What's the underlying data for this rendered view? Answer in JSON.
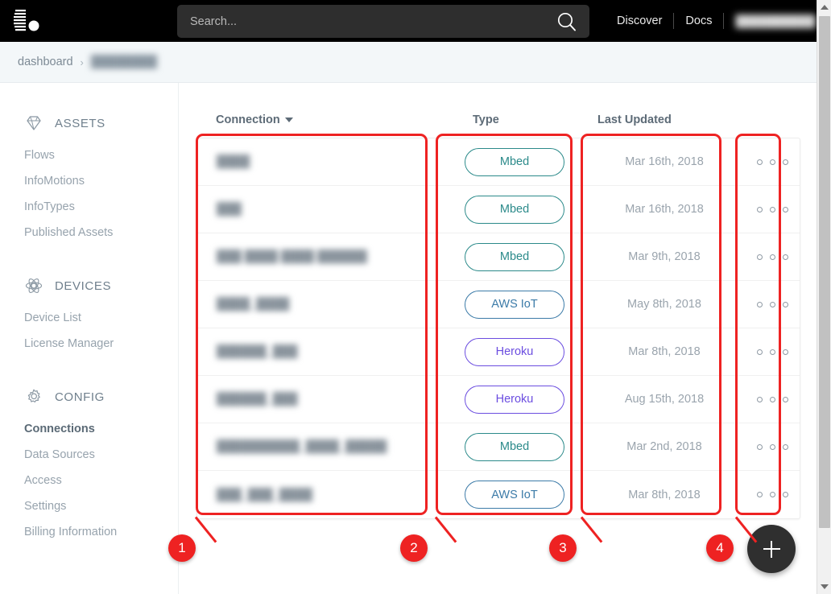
{
  "topbar": {
    "logo_icon": "logo-e-icon",
    "search": {
      "placeholder": "Search...",
      "value": "",
      "icon": "search-icon"
    },
    "links": [
      {
        "label": "Discover"
      },
      {
        "label": "Docs"
      }
    ],
    "user": {
      "name": "██████████",
      "caret_icon": "chevron-down-icon"
    }
  },
  "breadcrumb": {
    "root": "dashboard",
    "separator": "›",
    "current": "████████"
  },
  "sidebar": {
    "groups": [
      {
        "title": "ASSETS",
        "icon": "diamond-icon",
        "items": [
          {
            "label": "Flows",
            "active": false
          },
          {
            "label": "InfoMotions",
            "active": false
          },
          {
            "label": "InfoTypes",
            "active": false
          },
          {
            "label": "Published Assets",
            "active": false
          }
        ]
      },
      {
        "title": "DEVICES",
        "icon": "atom-icon",
        "items": [
          {
            "label": "Device List",
            "active": false
          },
          {
            "label": "License Manager",
            "active": false
          }
        ]
      },
      {
        "title": "CONFIG",
        "icon": "gear-icon",
        "items": [
          {
            "label": "Connections",
            "active": true
          },
          {
            "label": "Data Sources",
            "active": false
          },
          {
            "label": "Access",
            "active": false
          },
          {
            "label": "Settings",
            "active": false
          },
          {
            "label": "Billing Information",
            "active": false
          }
        ]
      }
    ]
  },
  "table": {
    "columns": [
      {
        "label": "Connection",
        "sortable": true,
        "sort_icon": "chevron-down-icon"
      },
      {
        "label": "Type",
        "sortable": false
      },
      {
        "label": "Last Updated",
        "sortable": false
      }
    ],
    "rows": [
      {
        "name": "████",
        "type": "Mbed",
        "updated": "Mar 16th, 2018",
        "actions_icon": "three-dots-icon"
      },
      {
        "name": "███",
        "type": "Mbed",
        "updated": "Mar 16th, 2018",
        "actions_icon": "three-dots-icon"
      },
      {
        "name": "███ ████ ████ ██████",
        "type": "Mbed",
        "updated": "Mar 9th, 2018",
        "actions_icon": "three-dots-icon"
      },
      {
        "name": "████_████",
        "type": "AWS IoT",
        "updated": "May 8th, 2018",
        "actions_icon": "three-dots-icon"
      },
      {
        "name": "██████_███",
        "type": "Heroku",
        "updated": "Mar 8th, 2018",
        "actions_icon": "three-dots-icon"
      },
      {
        "name": "██████_███",
        "type": "Heroku",
        "updated": "Aug 15th, 2018",
        "actions_icon": "three-dots-icon"
      },
      {
        "name": "██████████_████_█████",
        "type": "Mbed",
        "updated": "Mar 2nd, 2018",
        "actions_icon": "three-dots-icon"
      },
      {
        "name": "███_███_████",
        "type": "AWS IoT",
        "updated": "Mar 8th, 2018",
        "actions_icon": "three-dots-icon"
      }
    ]
  },
  "type_colors": {
    "Mbed": "#2b8a8a",
    "AWS IoT": "#3c7ba8",
    "Heroku": "#6b4de0"
  },
  "fab": {
    "label": "+",
    "icon": "plus-icon"
  },
  "annotations": {
    "accent": "#ee2222",
    "markers": [
      {
        "number": "1"
      },
      {
        "number": "2"
      },
      {
        "number": "3"
      },
      {
        "number": "4"
      }
    ]
  },
  "scrollbar": {
    "up_icon": "triangle-up-icon",
    "down_icon": "triangle-down-icon"
  }
}
